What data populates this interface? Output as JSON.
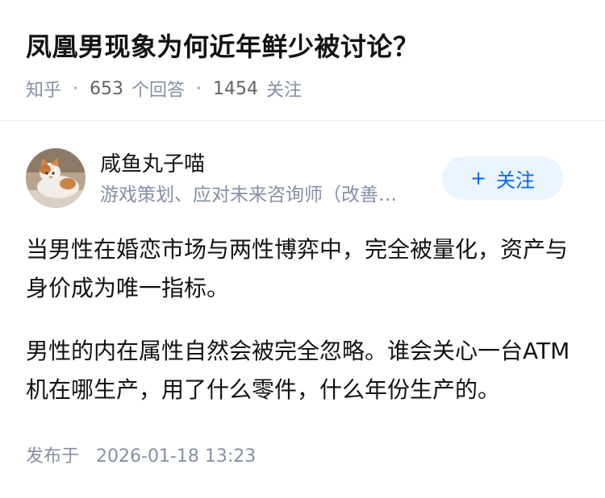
{
  "question": {
    "title": "凤凰男现象为何近年鲜少被讨论？",
    "source": "知乎",
    "separator": "·",
    "answer_count": "653",
    "answer_label": "个回答",
    "follow_count": "1454",
    "follow_label": "关注"
  },
  "author": {
    "name": "咸鱼丸子喵",
    "bio": "游戏策划、应对未来咨询师（改善…",
    "avatar_icon": "cat-photo-avatar",
    "follow_button": {
      "icon": "+",
      "label": "关注"
    }
  },
  "answer": {
    "paragraphs": [
      "当男性在婚恋市场与两性博弈中，完全被量化，资产与身价成为唯一指标。",
      "男性的内在属性自然会被完全忽略。谁会关心一台ATM机在哪生产，用了什么零件，什么年份生产的。"
    ],
    "publish_label": "发布于",
    "publish_time": "2026-01-18 13:23"
  },
  "colors": {
    "text_primary": "#121212",
    "text_secondary": "#8590a6",
    "accent": "#0066ff",
    "follow_bg": "#ebf5ff",
    "divider": "#ebebeb"
  }
}
